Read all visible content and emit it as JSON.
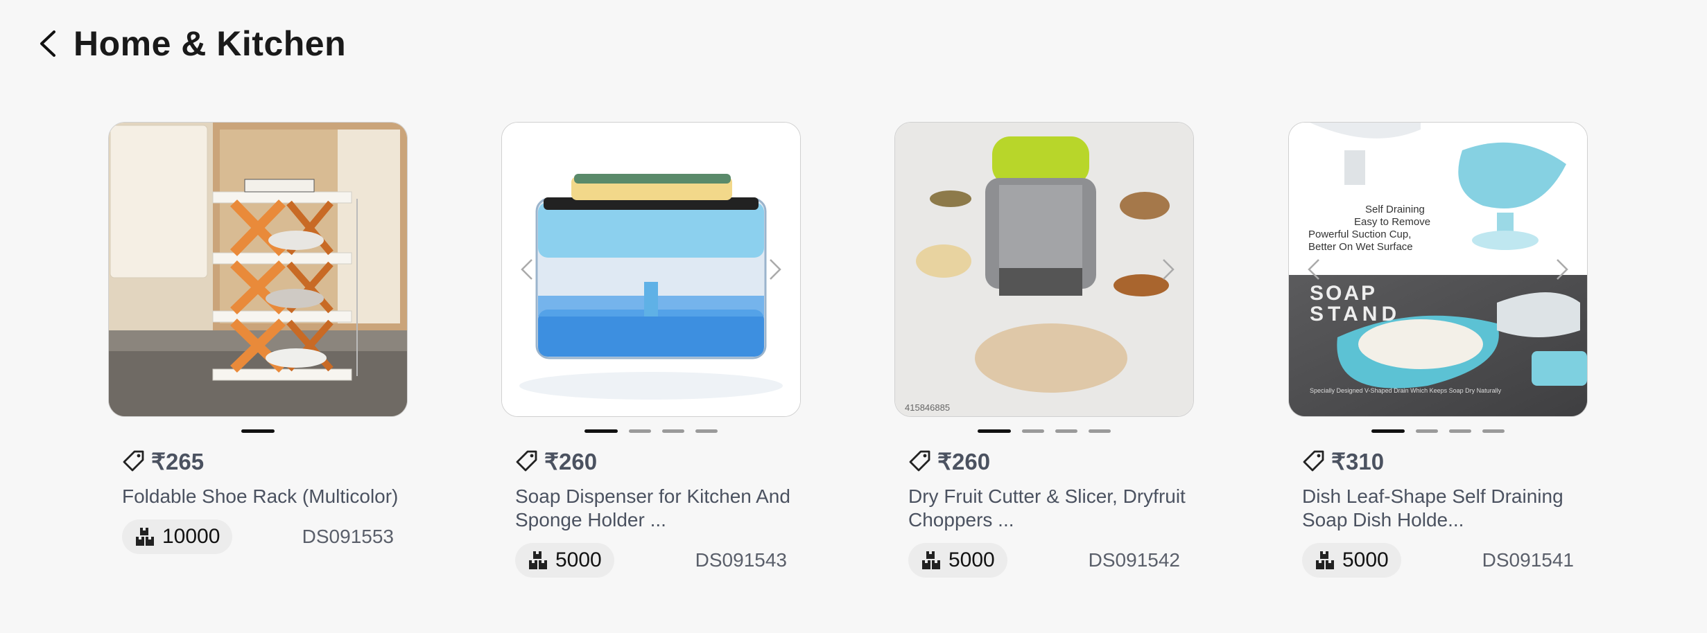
{
  "header": {
    "title": "Home & Kitchen"
  },
  "products": [
    {
      "price": "₹265",
      "name": "Foldable Shoe Rack (Multicolor)",
      "stock": "10000",
      "sku": "DS091553"
    },
    {
      "price": "₹260",
      "name": "Soap Dispenser for Kitchen And Sponge Holder ...",
      "stock": "5000",
      "sku": "DS091543"
    },
    {
      "price": "₹260",
      "name": "Dry Fruit Cutter & Slicer, Dryfruit Choppers ...",
      "stock": "5000",
      "sku": "DS091542",
      "image_text": "415846885"
    },
    {
      "price": "₹310",
      "name": "Dish Leaf-Shape Self Draining Soap Dish Holde...",
      "stock": "5000",
      "sku": "DS091541",
      "image_text": {
        "callouts": [
          "Self Draining",
          "Easy to Remove",
          "Powerful Suction Cup,",
          "Better On Wet Surface"
        ],
        "brand_1": "SOAP",
        "brand_2": "STAND",
        "caption": "Specially Designed V-Shaped Drain Which Keeps Soap Dry Naturally"
      }
    }
  ],
  "icons": {
    "back": "chevron-left-icon",
    "price": "price-tag-icon",
    "stock": "boxes-icon",
    "prev": "chevron-left-icon",
    "next": "chevron-right-icon"
  }
}
